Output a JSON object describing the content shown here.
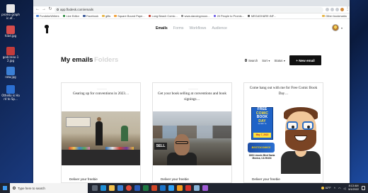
{
  "desktop": {
    "icons": [
      {
        "label": "promo graphic.af...",
        "color": "#e8e8e8"
      },
      {
        "label": "fcbd.jpg",
        "color": "#d64c4c"
      },
      {
        "label": "godcreno 12.jpg",
        "color": "#c23b3b"
      },
      {
        "label": "new.jpg",
        "color": "#3a7fd5"
      },
      {
        "label": "Othello is Hard to Sp...",
        "color": "#2b6fd1"
      }
    ]
  },
  "browser": {
    "url": "app.flodesk.com/emails",
    "bookmarks": [
      {
        "label": "FundsforWriters",
        "color": "#4a7fd4"
      },
      {
        "label": "Live Editor",
        "color": "#2b8a3e"
      },
      {
        "label": "Facebook",
        "color": "#3b5998"
      },
      {
        "label": "gifts",
        "color": "#e8b84a"
      },
      {
        "label": "Square Bound Pape...",
        "color": "#f2a23a"
      },
      {
        "label": "Long Beach Comic...",
        "color": "#c0392b"
      },
      {
        "label": "www.dancingmoon...",
        "color": "#888888"
      },
      {
        "label": "20 People to Promis...",
        "color": "#6c5ce7"
      },
      {
        "label": "MEGASHARE.INF...",
        "color": "#555555"
      }
    ],
    "other_bookmarks": "Other bookmarks"
  },
  "app": {
    "nav": [
      "Emails",
      "Forms",
      "Workflows",
      "Audience"
    ],
    "active_nav": "Emails",
    "tabs": {
      "my_emails": "My emails",
      "folders": "Folders"
    },
    "controls": {
      "search": "Search",
      "sort": "Sort",
      "status": "Status",
      "new_email": "+ New email"
    },
    "cards": [
      {
        "title": "Gearing up for conventions in 2023…",
        "footer": "Deliver your freebie"
      },
      {
        "title": "Get your book selling at conventions and book signings…",
        "footer": "Deliver your freebie",
        "image_text": "SELL"
      },
      {
        "title": "Come hang out with me for Free Comic Book Day…",
        "footer": "Deliver your freebie",
        "poster": {
          "line1": "FREE",
          "line2": "COMIC",
          "line3": "BOOK",
          "line4": "DAY",
          "sub": "Sat MAY 7th",
          "date": "May 7, 2022",
          "store": "BSSTOCOMICS",
          "address": "1863 Lincoln Blvd Santa Monica, CA 90404"
        }
      }
    ]
  },
  "taskbar": {
    "search_placeholder": "Type here to search",
    "apps": [
      {
        "name": "task-view",
        "color": "#5b6472"
      },
      {
        "name": "edge",
        "color": "#1f8fd6"
      },
      {
        "name": "file-explorer",
        "color": "#f2c14e"
      },
      {
        "name": "store",
        "color": "#3a7fd5"
      },
      {
        "name": "chrome",
        "color": "#e24a3b"
      },
      {
        "name": "word",
        "color": "#2b5bb8"
      },
      {
        "name": "excel",
        "color": "#1f7a43"
      },
      {
        "name": "powerpoint",
        "color": "#d24726"
      },
      {
        "name": "outlook",
        "color": "#1a73c8"
      },
      {
        "name": "photoshop",
        "color": "#2fa3f7"
      },
      {
        "name": "illustrator",
        "color": "#f29b1d"
      },
      {
        "name": "acrobat",
        "color": "#d5322b"
      },
      {
        "name": "notepad",
        "color": "#8ab4d8"
      },
      {
        "name": "media",
        "color": "#a05cd6"
      }
    ],
    "weather": "62°F",
    "time": "8:13 AM",
    "date": "5/1/2022"
  }
}
